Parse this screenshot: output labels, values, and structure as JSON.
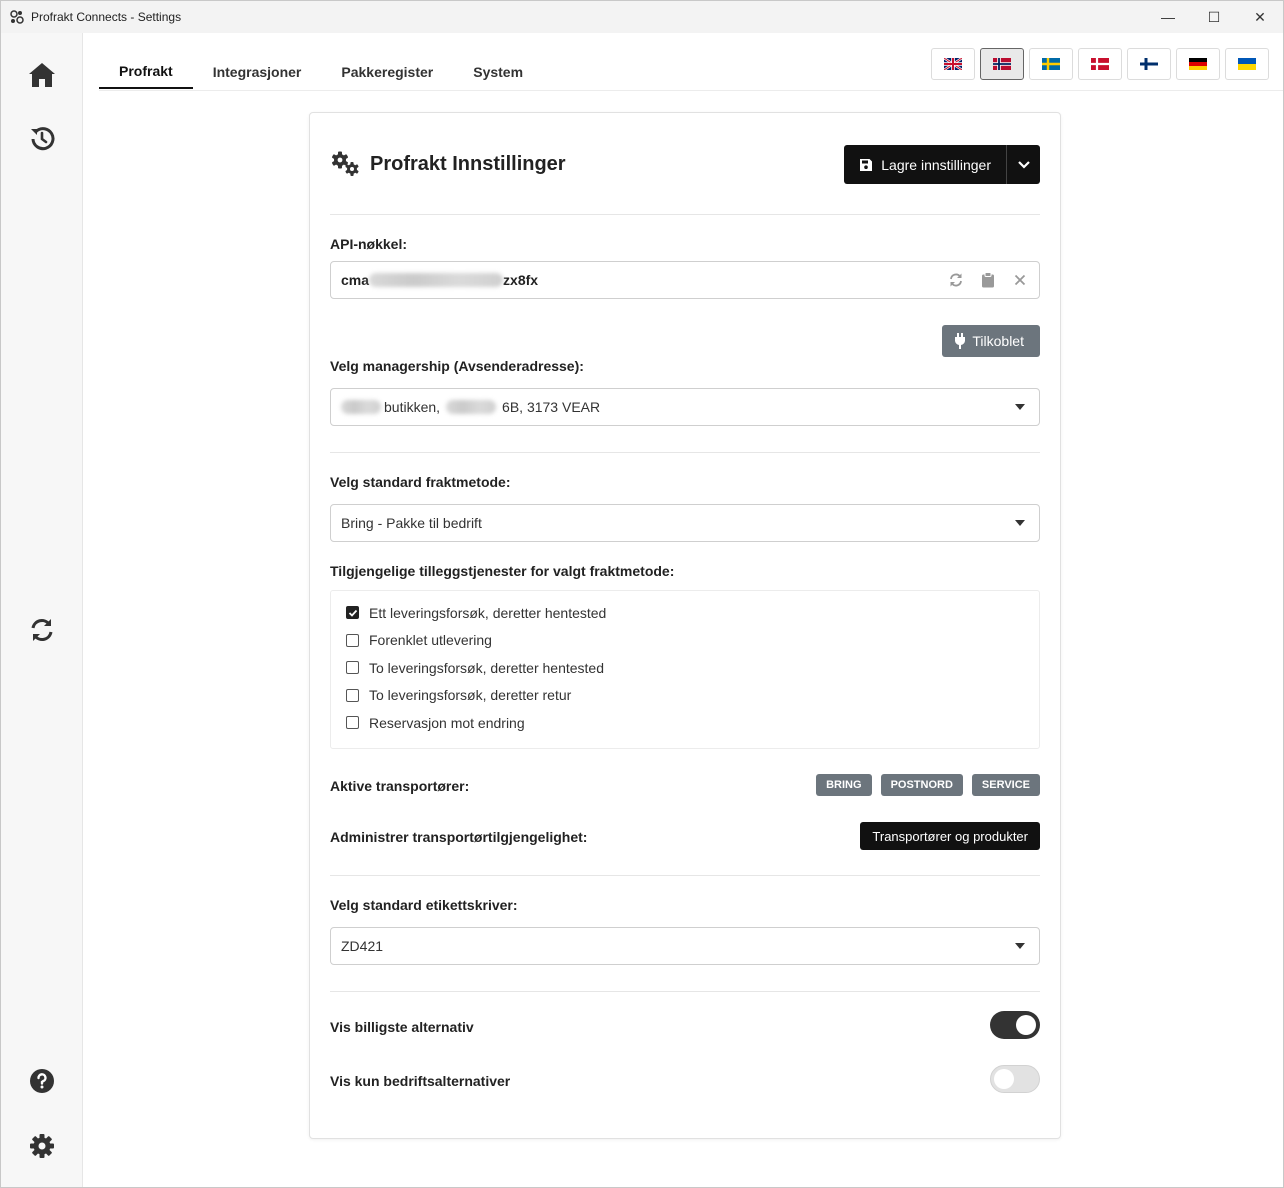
{
  "window": {
    "title": "Profrakt Connects - Settings",
    "controls": {
      "minimize": "—",
      "maximize": "☐",
      "close": "✕"
    }
  },
  "sidebar": {
    "items": [
      {
        "name": "home",
        "icon": "home-icon"
      },
      {
        "name": "history",
        "icon": "history-icon"
      },
      {
        "name": "sync",
        "icon": "sync-icon"
      },
      {
        "name": "help",
        "icon": "help-icon"
      },
      {
        "name": "settings",
        "icon": "gear-icon"
      }
    ]
  },
  "tabs": [
    {
      "label": "Profrakt",
      "active": true
    },
    {
      "label": "Integrasjoner",
      "active": false
    },
    {
      "label": "Pakkeregister",
      "active": false
    },
    {
      "label": "System",
      "active": false
    }
  ],
  "languages": [
    {
      "code": "en",
      "icon": "flag-uk-icon",
      "active": false
    },
    {
      "code": "no",
      "icon": "flag-norway-icon",
      "active": true
    },
    {
      "code": "sv",
      "icon": "flag-sweden-icon",
      "active": false
    },
    {
      "code": "da",
      "icon": "flag-denmark-icon",
      "active": false
    },
    {
      "code": "fi",
      "icon": "flag-finland-icon",
      "active": false
    },
    {
      "code": "de",
      "icon": "flag-germany-icon",
      "active": false
    },
    {
      "code": "uk",
      "icon": "flag-ukraine-icon",
      "active": false
    }
  ],
  "card": {
    "title": "Profrakt Innstillinger",
    "save_label": "Lagre innstillinger",
    "api": {
      "label": "API-nøkkel:",
      "value_start": "cma",
      "value_end": "zx8fx"
    },
    "connected_label": "Tilkoblet",
    "managership": {
      "label": "Velg managership (Avsenderadresse):",
      "value_part1": "butikken,",
      "value_part2": "6B, 3173 VEAR"
    },
    "freight": {
      "label": "Velg standard fraktmetode:",
      "value": "Bring - Pakke til bedrift"
    },
    "services": {
      "label": "Tilgjengelige tilleggstjenester for valgt fraktmetode:",
      "items": [
        {
          "label": "Ett leveringsforsøk, deretter hentested",
          "checked": true
        },
        {
          "label": "Forenklet utlevering",
          "checked": false
        },
        {
          "label": "To leveringsforsøk, deretter hentested",
          "checked": false
        },
        {
          "label": "To leveringsforsøk, deretter retur",
          "checked": false
        },
        {
          "label": "Reservasjon mot endring",
          "checked": false
        }
      ]
    },
    "carriers": {
      "label": "Aktive transportører:",
      "badges": [
        "BRING",
        "POSTNORD",
        "SERVICE"
      ]
    },
    "manage": {
      "label": "Administrer transportørtilgjengelighet:",
      "button": "Transportører og produkter"
    },
    "printer": {
      "label": "Velg standard etikettskriver:",
      "value": "ZD421"
    },
    "toggles": [
      {
        "label": "Vis billigste alternativ",
        "on": true
      },
      {
        "label": "Vis kun bedriftsalternativer",
        "on": false
      }
    ]
  },
  "colors": {
    "primary": "#111111",
    "secondary_badge": "#6c757d",
    "norway_red": "#ba0c2f",
    "norway_blue": "#00205b"
  }
}
